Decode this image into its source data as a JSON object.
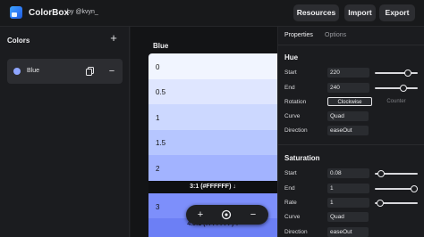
{
  "header": {
    "brand": "ColorBox",
    "byline": "by @kvyn_",
    "resources_label": "Resources",
    "import_label": "Import",
    "export_label": "Export"
  },
  "sidebar": {
    "title": "Colors",
    "items": [
      {
        "label": "Blue",
        "swatch_color": "#8fa6ff"
      }
    ]
  },
  "palette": {
    "title": "Blue",
    "shades": [
      {
        "label": "0",
        "bg": "#f1f5ff",
        "text": "#111111"
      },
      {
        "label": "0.5",
        "bg": "#dfe6ff",
        "text": "#111111"
      },
      {
        "label": "1",
        "bg": "#ccd8ff",
        "text": "#111111"
      },
      {
        "label": "1.5",
        "bg": "#b6c6ff",
        "text": "#111111"
      },
      {
        "label": "2",
        "bg": "#a2b3ff",
        "text": "#111111"
      },
      {
        "label": "3",
        "bg": "#7d8ffb",
        "text": "#111111"
      }
    ],
    "contrast_1": "3:1 (#FFFFFF) ↓",
    "contrast_2": "4.5:1 (#FFFFFF) ↓"
  },
  "panel": {
    "tabs": [
      "Properties",
      "Options"
    ],
    "hue": {
      "title": "Hue",
      "start_label": "Start",
      "start_value": "220",
      "start_level": 0.82,
      "end_label": "End",
      "end_value": "240",
      "end_level": 0.7,
      "rotation_label": "Rotation",
      "rotation_on": "Clockwise",
      "rotation_off": "Counter",
      "curve_label": "Curve",
      "curve_value": "Quad",
      "direction_label": "Direction",
      "direction_value": "easeOut"
    },
    "saturation": {
      "title": "Saturation",
      "start_label": "Start",
      "start_value": "0.08",
      "start_level": 0.08,
      "end_label": "End",
      "end_value": "1",
      "end_level": 1,
      "rate_label": "Rate",
      "rate_value": "1",
      "rate_level": 0.05,
      "curve_label": "Curve",
      "curve_value": "Quad",
      "direction_label": "Direction",
      "direction_value": "easeOut"
    }
  }
}
